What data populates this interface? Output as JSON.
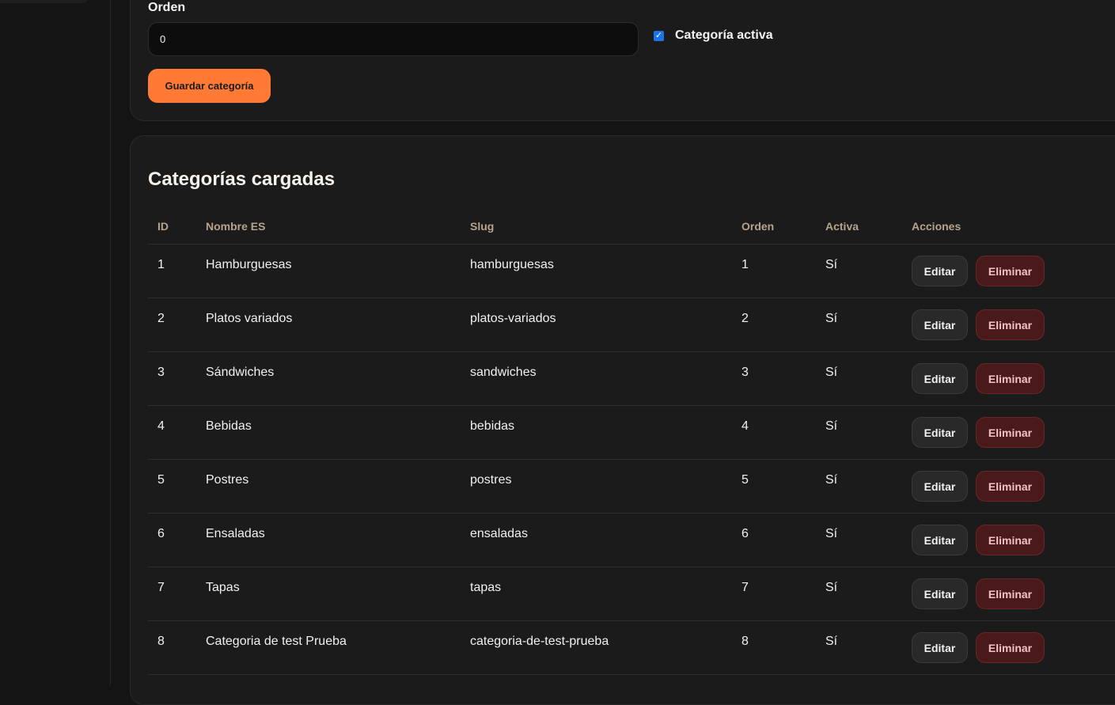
{
  "form": {
    "orden_label": "Orden",
    "orden_value": "0",
    "checkbox_label": "Categoría activa",
    "checkbox_checked": true,
    "save_label": "Guardar categoría",
    "save_color": "#ff7a35"
  },
  "table_section": {
    "title": "Categorías cargadas",
    "headers": {
      "id": "ID",
      "name": "Nombre ES",
      "slug": "Slug",
      "orden": "Orden",
      "activa": "Activa",
      "acciones": "Acciones"
    },
    "edit_label": "Editar",
    "delete_label": "Eliminar",
    "rows": [
      {
        "id": "1",
        "name": "Hamburguesas",
        "slug": "hamburguesas",
        "orden": "1",
        "activa": "Sí"
      },
      {
        "id": "2",
        "name": "Platos variados",
        "slug": "platos-variados",
        "orden": "2",
        "activa": "Sí"
      },
      {
        "id": "3",
        "name": "Sándwiches",
        "slug": "sandwiches",
        "orden": "3",
        "activa": "Sí"
      },
      {
        "id": "4",
        "name": "Bebidas",
        "slug": "bebidas",
        "orden": "4",
        "activa": "Sí"
      },
      {
        "id": "5",
        "name": "Postres",
        "slug": "postres",
        "orden": "5",
        "activa": "Sí"
      },
      {
        "id": "6",
        "name": "Ensaladas",
        "slug": "ensaladas",
        "orden": "6",
        "activa": "Sí"
      },
      {
        "id": "7",
        "name": "Tapas",
        "slug": "tapas",
        "orden": "7",
        "activa": "Sí"
      },
      {
        "id": "8",
        "name": "Categoria de test Prueba",
        "slug": "categoria-de-test-prueba",
        "orden": "8",
        "activa": "Sí"
      }
    ]
  }
}
